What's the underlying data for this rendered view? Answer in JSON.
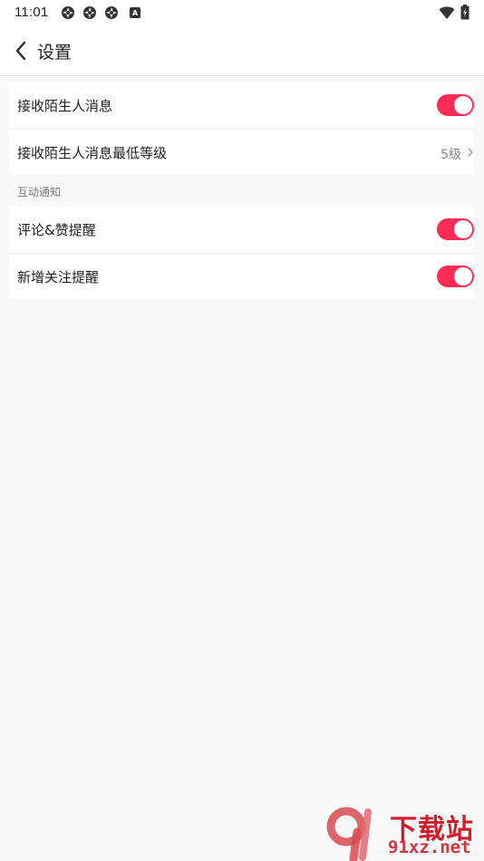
{
  "status_bar": {
    "time": "11:01",
    "left_icons": [
      "aperture-icon",
      "aperture-icon",
      "aperture-icon"
    ],
    "a_badge": "A",
    "right_icons": [
      "wifi-icon",
      "battery-icon"
    ]
  },
  "header": {
    "title": "设置",
    "back_icon": "chevron-left-icon"
  },
  "section1": {
    "items": [
      {
        "label": "接收陌生人消息",
        "type": "toggle",
        "on": true
      },
      {
        "label": "接收陌生人消息最低等级",
        "type": "value",
        "value": "5级"
      }
    ]
  },
  "section2": {
    "title": "互动通知",
    "items": [
      {
        "label": "评论&赞提醒",
        "type": "toggle",
        "on": true
      },
      {
        "label": "新增关注提醒",
        "type": "toggle",
        "on": true
      }
    ]
  },
  "watermark": {
    "title": "下载站",
    "url": "91xz.net"
  },
  "colors": {
    "accent": "#fe2c55",
    "background": "#f8f8f8",
    "card": "#ffffff",
    "watermark": "#cf1e2b"
  }
}
